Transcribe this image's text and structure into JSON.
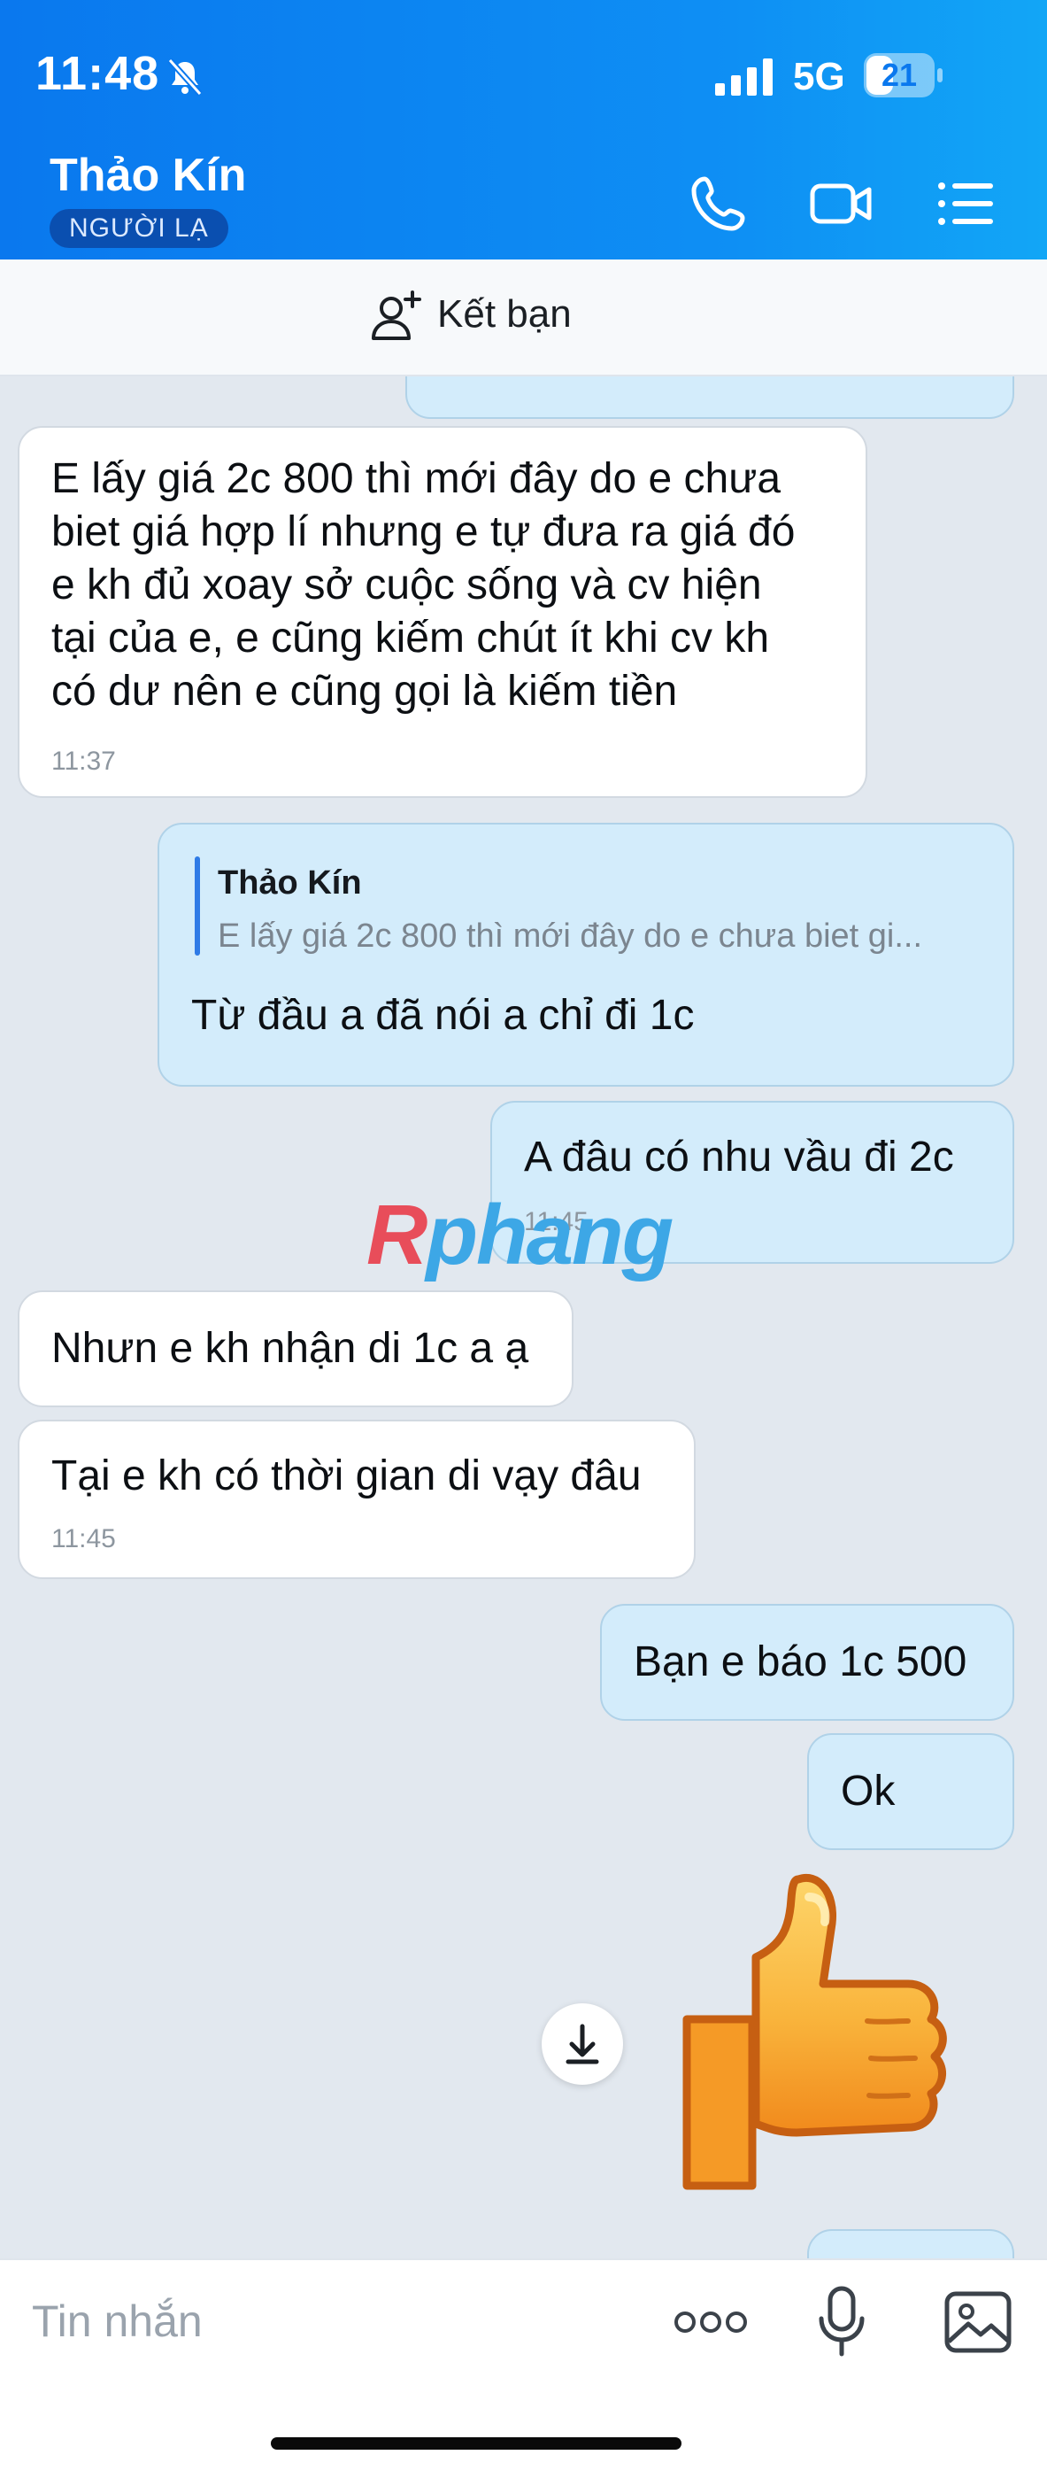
{
  "status_bar": {
    "time": "11:48",
    "network": "5G",
    "battery": "21"
  },
  "header": {
    "contact_name": "Thảo Kín",
    "badge": "NGƯỜI LẠ",
    "icons": [
      "phone-icon",
      "video-call-icon",
      "menu-icon"
    ]
  },
  "add_friend": {
    "label": "Kết bạn",
    "icon": "add-user-icon"
  },
  "messages": [
    {
      "side": "in",
      "text": "E lấy giá 2c 800 thì mới đây do e chưa\nbiet giá hợp lí nhưng e tự đưa ra giá đó\ne kh đủ xoay sở cuộc sống và cv hiện\ntại của e, e cũng kiếm chút ít khi cv kh\ncó dư nên e cũng gọi là kiếm tiền",
      "time": "11:37"
    },
    {
      "side": "out",
      "quote_author": "Thảo Kín",
      "quote_text": "E lấy giá 2c 800 thì mới đây do e chưa biet gi...",
      "text": "Từ đầu a đã nói a chỉ đi 1c"
    },
    {
      "side": "out",
      "text": "A đâu có nhu vầu đi 2c",
      "time": "11:45"
    },
    {
      "side": "in",
      "text": "Nhưn e kh nhận di 1c a ạ"
    },
    {
      "side": "in",
      "text": "Tại e kh có thời gian di vạy đâu",
      "time": "11:45"
    },
    {
      "side": "out",
      "text": "Bạn e báo 1c 500"
    },
    {
      "side": "out",
      "text": "Ok"
    }
  ],
  "sticker": {
    "name": "thumbs-up-sticker"
  },
  "watermark": {
    "part1": "R",
    "part2": "phang"
  },
  "composer": {
    "placeholder": "Tin nhắn",
    "icons": [
      "more-icon",
      "microphone-icon",
      "image-icon"
    ]
  },
  "colors": {
    "header_start": "#0a78ee",
    "header_end": "#12a6f6",
    "outgoing_bubble": "#d3ecfb",
    "incoming_bubble": "#ffffff",
    "chat_bg": "#e2e8ef"
  }
}
